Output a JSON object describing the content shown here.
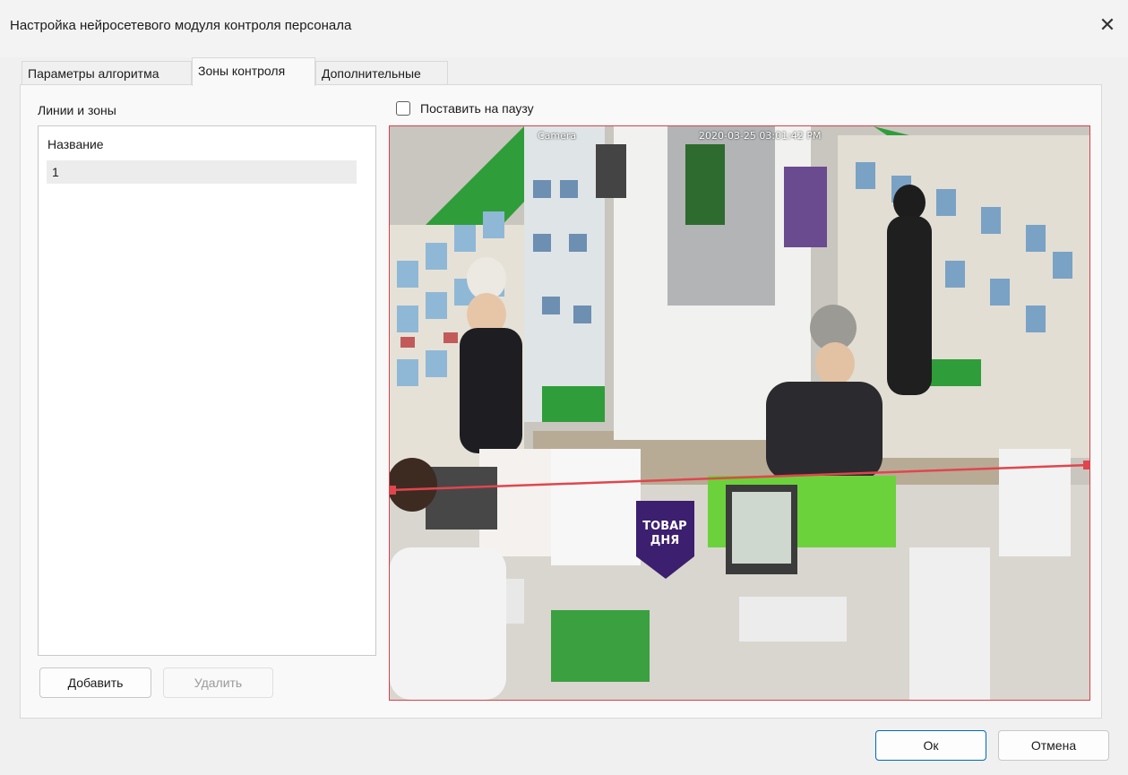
{
  "window": {
    "title": "Настройка нейросетевого модуля контроля персонала",
    "close_glyph": "✕"
  },
  "tabs": [
    {
      "label": "Параметры алгоритма",
      "active": false
    },
    {
      "label": "Зоны контроля",
      "active": true
    },
    {
      "label": "Дополнительные",
      "active": false
    }
  ],
  "zones": {
    "section_label": "Линии и зоны",
    "column_header": "Название",
    "items": [
      "1"
    ],
    "add_label": "Добавить",
    "delete_label": "Удалить"
  },
  "video": {
    "pause_label": "Поставить на паузу",
    "pause_checked": false,
    "camera_label": "Camera",
    "timestamp": "2020-03-25 03:01:42 PM",
    "sign_text": [
      "ТОВАР",
      "ДНЯ"
    ],
    "line_color": "#e0464e"
  },
  "footer": {
    "ok_label": "Ок",
    "cancel_label": "Отмена"
  },
  "colors": {
    "accent": "#0067c0",
    "zone_line": "#e0464e",
    "pharmacy_green": "#2f9e3a"
  }
}
